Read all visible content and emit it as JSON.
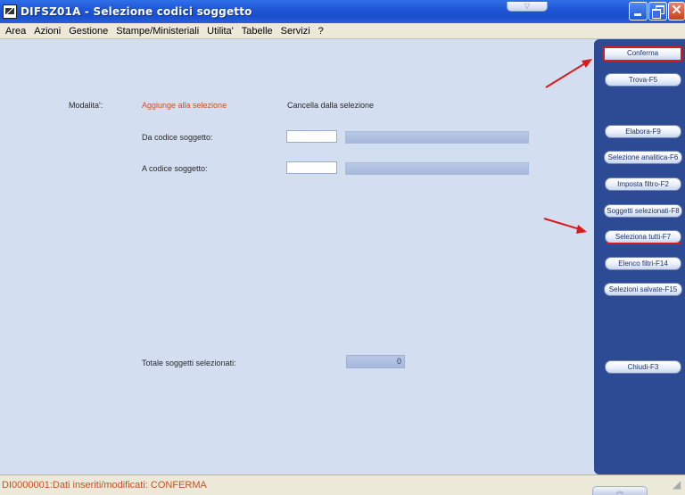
{
  "window": {
    "title": "DIFSZ01A - Selezione codici soggetto",
    "dropdown_glyph": "▽",
    "close_glyph": "✕"
  },
  "menu": [
    "Area",
    "Azioni",
    "Gestione",
    "Stampe/Ministeriali",
    "Utilita'",
    "Tabelle",
    "Servizi",
    "?"
  ],
  "form": {
    "modalita_label": "Modalita':",
    "option_add": "Aggiunge alla selezione",
    "option_remove": "Cancella dalla selezione",
    "da_label": "Da   codice soggetto:",
    "da_value": "",
    "a_label": "A     codice soggetto:",
    "a_value": "",
    "totale_label": "Totale soggetti selezionati:",
    "totale_value": "0"
  },
  "buttons": {
    "conferma": "Conferma",
    "trova": "Trova-F5",
    "elabora": "Elabora-F9",
    "selezione_analitica": "Selezione analitica-F6",
    "imposta_filtro": "Imposta filtro-F2",
    "soggetti_selezionati": "Soggetti selezionati-F8",
    "seleziona_tutti": "Seleziona tutti-F7",
    "elenco_filtri": "Elenco filtri-F14",
    "selezioni_salvate": "Selezioni salvate-F15",
    "chiudi": "Chiudi-F3"
  },
  "status": {
    "message": "DI0000001:Dati inseriti/modificati: CONFERMA",
    "grip_glyph": "︽"
  },
  "colors": {
    "accent_red": "#d91a1a",
    "orange_text": "#c0542a",
    "panel_blue": "#2d4a95"
  }
}
